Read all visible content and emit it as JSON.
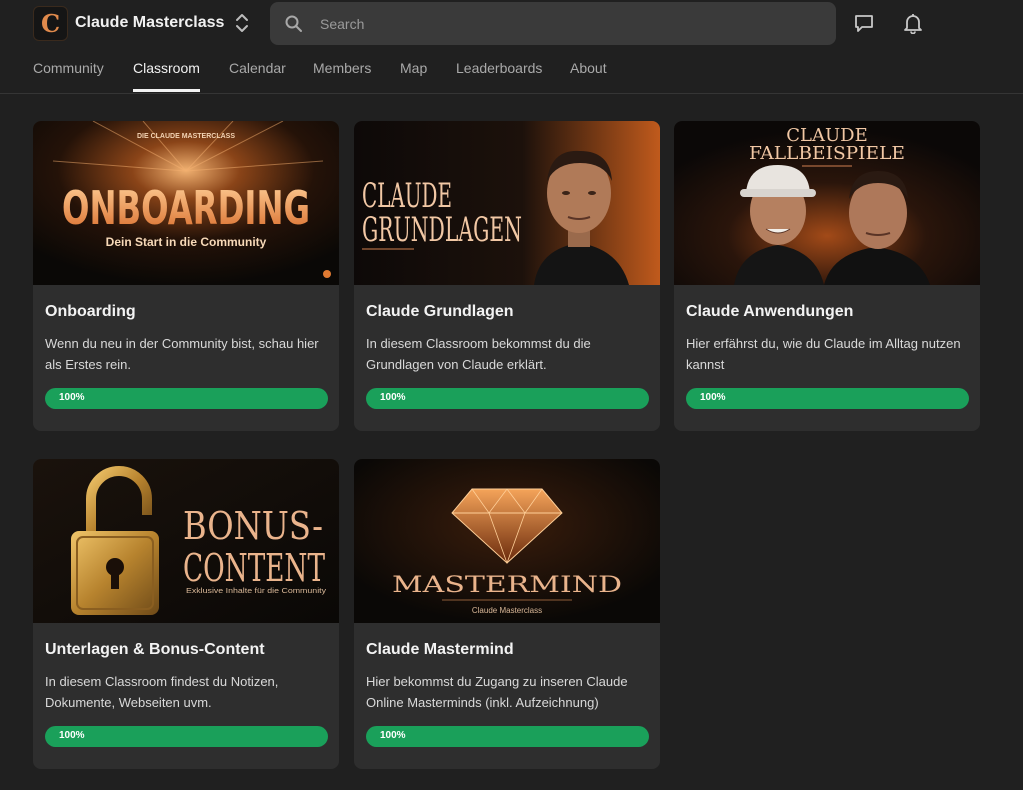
{
  "header": {
    "brand": "Claude Masterclass",
    "logo_letter": "C",
    "search_placeholder": "Search"
  },
  "tabs": [
    {
      "label": "Community"
    },
    {
      "label": "Classroom",
      "active": true
    },
    {
      "label": "Calendar"
    },
    {
      "label": "Members"
    },
    {
      "label": "Map"
    },
    {
      "label": "Leaderboards"
    },
    {
      "label": "About"
    }
  ],
  "courses": [
    {
      "title": "Onboarding",
      "description": "Wenn du neu in der Community bist, schau hier als Erstes rein.",
      "progress_label": "100%",
      "progress": 1.0,
      "image": {
        "kicker": "DIE CLAUDE MASTERCLASS",
        "headline": "ONBOARDING",
        "subline": "Dein Start in die Community"
      }
    },
    {
      "title": "Claude Grundlagen",
      "description": "In diesem Classroom bekommst du die Grundlagen von Claude erklärt.",
      "progress_label": "100%",
      "progress": 1.0,
      "image": {
        "line1": "CLAUDE",
        "line2": "GRUNDLAGEN"
      }
    },
    {
      "title": "Claude Anwendungen",
      "description": "Hier erfährst du, wie du Claude im Alltag nutzen kannst",
      "progress_label": "100%",
      "progress": 1.0,
      "image": {
        "line1": "CLAUDE",
        "line2": "FALLBEISPIELE"
      }
    },
    {
      "title": "Unterlagen & Bonus-Content",
      "description": "In diesem Classroom findest du Notizen, Dokumente, Webseiten uvm.",
      "progress_label": "100%",
      "progress": 1.0,
      "image": {
        "line1": "BONUS-",
        "line2": "CONTENT",
        "subline": "Exklusive Inhalte für die Community"
      }
    },
    {
      "title": "Claude Mastermind",
      "description": "Hier bekommst du Zugang zu inseren Claude Online Masterminds (inkl. Aufzeichnung)",
      "progress_label": "100%",
      "progress": 1.0,
      "image": {
        "headline": "MASTERMIND",
        "subline": "Claude Masterclass"
      }
    }
  ],
  "colors": {
    "background": "#202020",
    "card": "#2e2e2e",
    "progress": "#1aa05a",
    "accent_orange": "#e08a4c"
  }
}
